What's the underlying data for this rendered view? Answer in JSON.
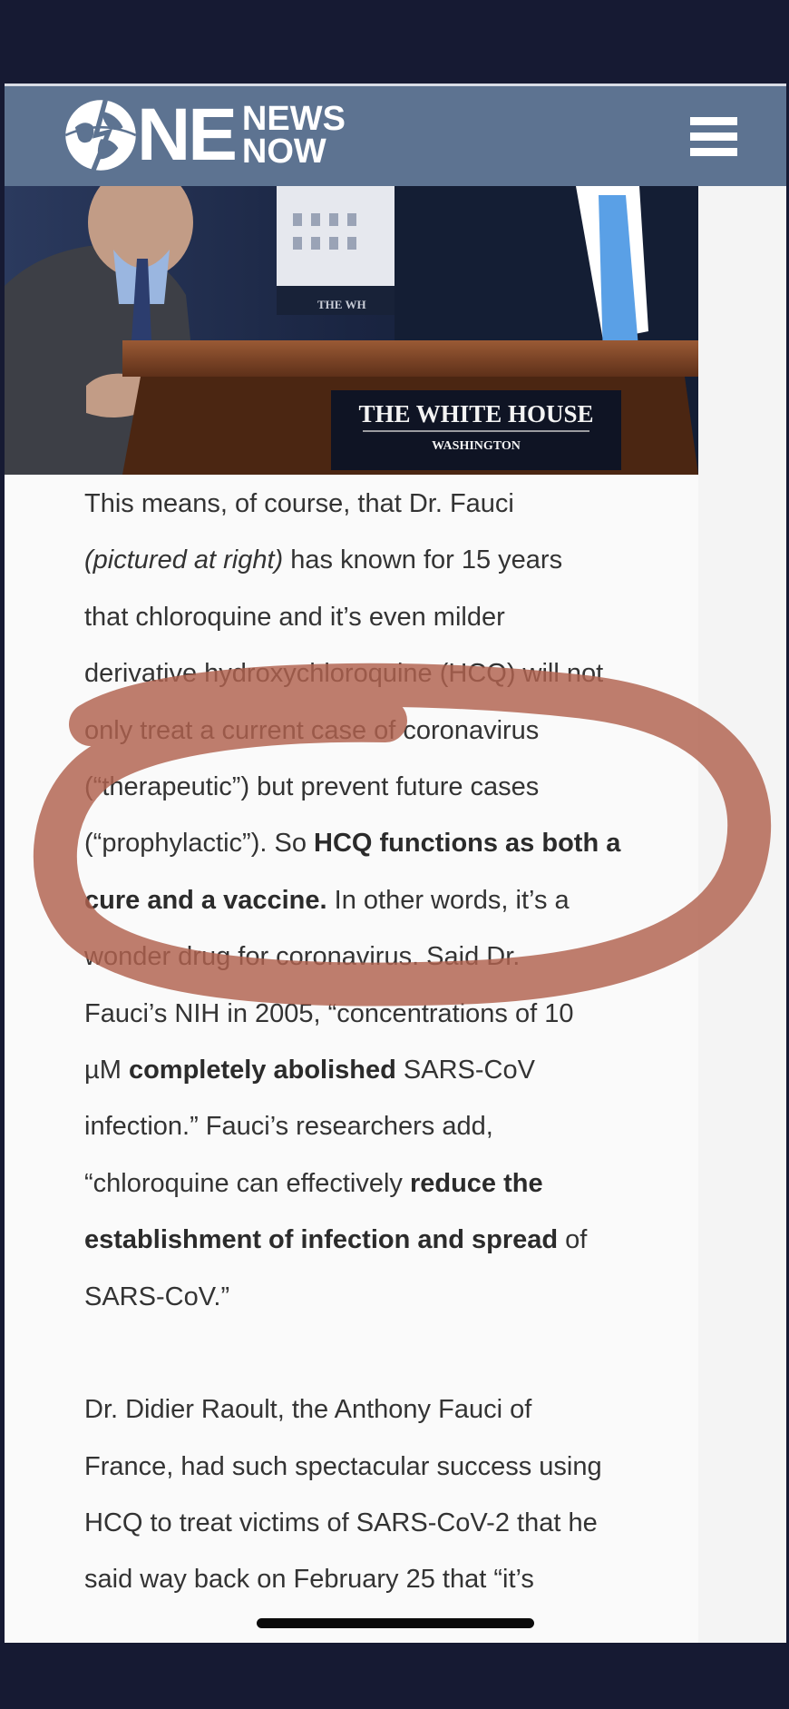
{
  "header": {
    "logo_main": "NE",
    "logo_line1": "NEWS",
    "logo_line2": "NOW",
    "menu_icon": "hamburger-menu-icon"
  },
  "photo": {
    "podium_title": "THE WHITE HOUSE",
    "podium_subtitle": "WASHINGTON",
    "backdrop_text": "THE WH"
  },
  "article": {
    "p1_lines": [
      "This means, of course, that Dr. Fauci",
      "(pictured at right)",
      " has known for 15 years",
      "that chloroquine and it’s even milder",
      "derivative hydroxychloroquine (HCQ) will not",
      "only treat a current case of coronavirus",
      "(“therapeutic”) but prevent future cases",
      "(“prophylactic”). So ",
      "HCQ functions as both a",
      "cure and a vaccine.",
      " In other words, it’s a",
      "wonder drug for coronavirus. Said Dr.",
      "Fauci’s NIH in 2005, “concentrations of 10",
      "µM ",
      "completely abolished",
      " SARS-CoV",
      "infection.” Fauci’s researchers add,",
      "“chloroquine can effectively ",
      "reduce the",
      "establishment of infection and spread",
      " of",
      "SARS-CoV.”"
    ],
    "p2_lines": [
      "Dr. Didier Raoult, the Anthony Fauci of",
      "France, had such spectacular success using",
      "HCQ to treat victims of SARS-CoV-2 that he",
      "said way back on February 25 that “it’s"
    ]
  },
  "colors": {
    "header_bg": "#5d7391",
    "page_bg": "#161a33",
    "annotation_circle": "#b1624e"
  }
}
